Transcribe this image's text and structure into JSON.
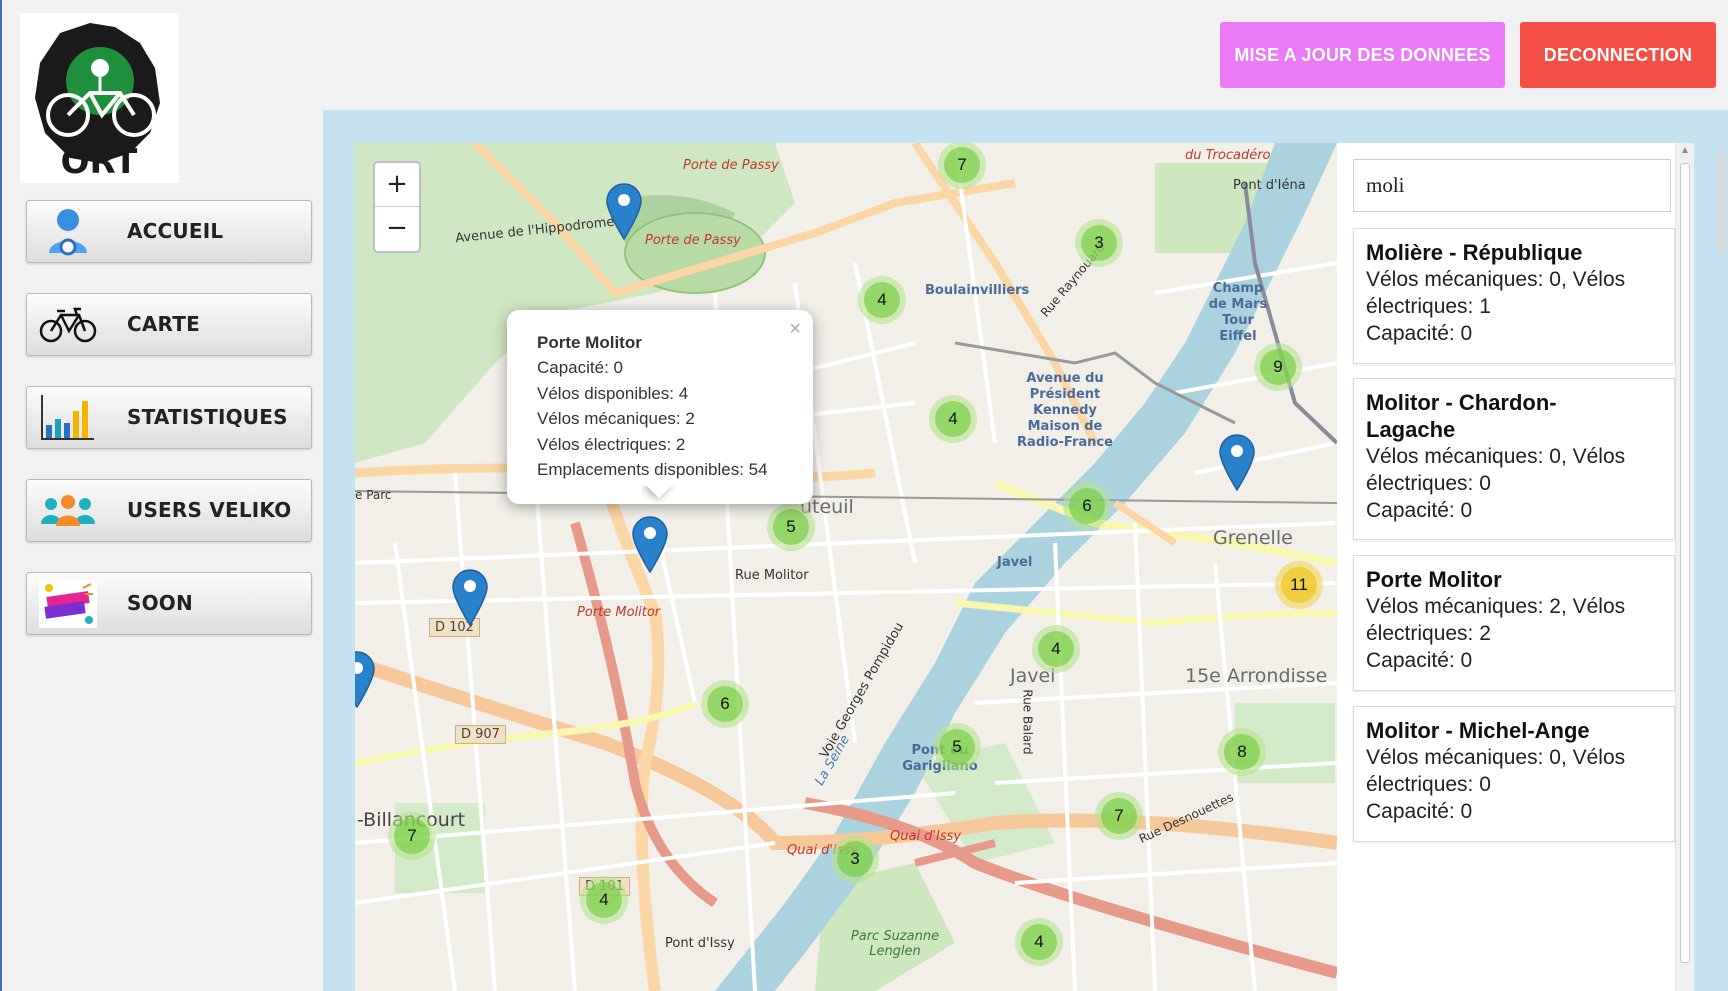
{
  "logo": {
    "text": "ORT"
  },
  "top_buttons": {
    "update": "MISE A JOUR DES DONNEES",
    "logout": "DECONNECTION"
  },
  "nav": [
    {
      "label": "ACCUEIL",
      "icon": "user-gear-icon"
    },
    {
      "label": "CARTE",
      "icon": "bicycle-icon"
    },
    {
      "label": "STATISTIQUES",
      "icon": "bar-chart-icon"
    },
    {
      "label": "USERS VELIKO",
      "icon": "users-group-icon"
    },
    {
      "label": "SOON",
      "icon": "coming-soon-icon"
    }
  ],
  "colors": {
    "update_button": "#ea7af6",
    "logout_button": "#f34f44",
    "panel_bg": "#c5e2f0",
    "marker": "#2a81cb"
  },
  "map": {
    "zoom_in": "+",
    "zoom_out": "−",
    "clusters": [
      "7",
      "3",
      "4",
      "4",
      "9",
      "6",
      "5",
      "11",
      "4",
      "6",
      "5",
      "8",
      "7",
      "7",
      "3",
      "4",
      "4"
    ],
    "labels": {
      "porte_passy_1": "Porte de Passy",
      "porte_passy_2": "Porte de Passy",
      "hippodrome": "Avenue de l'Hippodrome",
      "trocadero": "du Trocadéro",
      "pont_iena": "Pont d'Iéna",
      "boulainvilliers": "Boulainvilliers",
      "champ_mars": "Champ de Mars Tour Eiffel",
      "avenue_kennedy": "Avenue du Président Kennedy Maison de Radio-France",
      "auteuil": "uteuil",
      "grenelle": "Grenelle",
      "rue_molitor": "Rue Molitor",
      "porte_molitor": "Porte Molitor",
      "javel_metro": "Javel",
      "javel": "Javel",
      "arrondissement": "15e Arrondisse",
      "billancourt": "-Billancourt",
      "pont_garigliano": "Pont du Garigliano",
      "quai_issy_1": "Quai d'Issy",
      "quai_issy_2": "Quai d'Issy",
      "pont_issy": "Pont d'Issy",
      "parc_lenglen": "Parc Suzanne Lenglen",
      "voie_pompidou": "Voie Georges Pompidou",
      "la_seine": "La Seine",
      "rue_balard": "Rue Balard",
      "rue_desnouettes": "Rue Desnouettes",
      "rue_raynouard": "Rue Raynouard",
      "parc_left": "e Parc",
      "d102": "D 102",
      "d907": "D 907",
      "d101": "D 101"
    },
    "popup": {
      "title": "Porte Molitor",
      "lines": [
        "Capacité: 0",
        "Vélos disponibles: 4",
        "Vélos mécaniques: 2",
        "Vélos électriques: 2",
        "Emplacements disponibles: 54"
      ],
      "close": "×"
    }
  },
  "search": {
    "value": "moli",
    "results": [
      {
        "title": "Molière - République",
        "line1": "Vélos mécaniques: 0, Vélos",
        "line2": "électriques: 1",
        "line3": "Capacité: 0"
      },
      {
        "title": "Molitor - Chardon-",
        "title2": "Lagache",
        "line1": "Vélos mécaniques: 0, Vélos",
        "line2": "électriques: 0",
        "line3": "Capacité: 0"
      },
      {
        "title": "Porte Molitor",
        "line1": "Vélos mécaniques: 2, Vélos",
        "line2": "électriques: 2",
        "line3": "Capacité: 0"
      },
      {
        "title": "Molitor - Michel-Ange",
        "line1": "Vélos mécaniques: 0, Vélos",
        "line2": "électriques: 0",
        "line3": "Capacité: 0"
      }
    ]
  }
}
